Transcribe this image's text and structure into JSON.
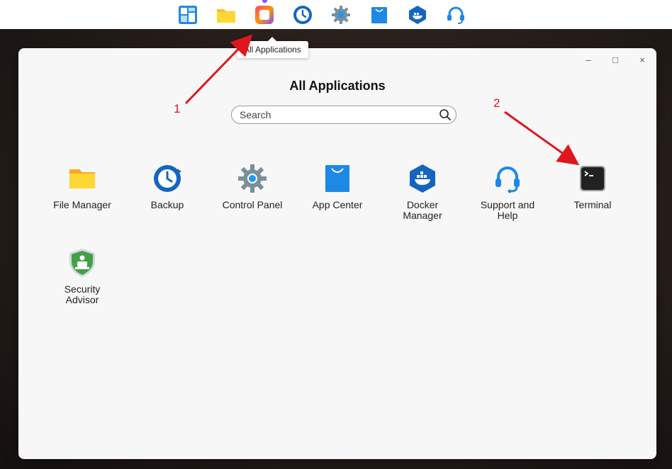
{
  "dock": {
    "items": [
      {
        "name": "dock-desktop-icon"
      },
      {
        "name": "dock-file-manager-icon"
      },
      {
        "name": "dock-all-applications-icon"
      },
      {
        "name": "dock-backup-icon"
      },
      {
        "name": "dock-control-panel-icon"
      },
      {
        "name": "dock-app-center-icon"
      },
      {
        "name": "dock-docker-icon"
      },
      {
        "name": "dock-support-icon"
      }
    ],
    "tooltip": "All Applications"
  },
  "window": {
    "title": "All Applications",
    "controls": {
      "minimize": "–",
      "maximize": "□",
      "close": "×"
    },
    "search": {
      "placeholder": "Search",
      "value": ""
    }
  },
  "apps": [
    {
      "label": "File Manager",
      "icon": "folder-icon"
    },
    {
      "label": "Backup",
      "icon": "backup-clock-icon"
    },
    {
      "label": "Control Panel",
      "icon": "gear-icon"
    },
    {
      "label": "App Center",
      "icon": "shopping-bag-icon"
    },
    {
      "label": "Docker Manager",
      "icon": "docker-icon"
    },
    {
      "label": "Support and Help",
      "icon": "headset-icon"
    },
    {
      "label": "Terminal",
      "icon": "terminal-icon"
    },
    {
      "label": "Security Advisor",
      "icon": "shield-icon"
    }
  ],
  "annotations": {
    "step1": "1",
    "step2": "2",
    "color": "#e0161e"
  }
}
